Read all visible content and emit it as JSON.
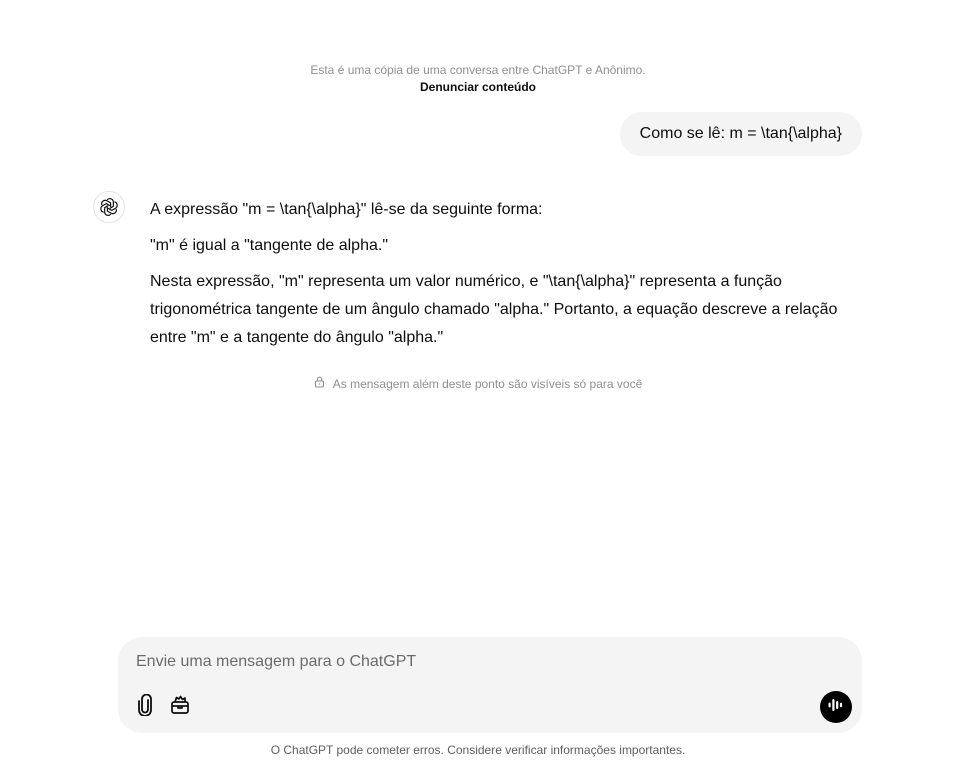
{
  "shared_notice": {
    "text": "Esta é uma cópia de uma conversa entre ChatGPT e Anônimo.",
    "report_link": "Denunciar conteúdo"
  },
  "conversation": {
    "user_message": "Como se lê: m = \\tan{\\alpha}",
    "assistant_paragraphs": [
      "A expressão \"m = \\tan{\\alpha}\" lê-se da seguinte forma:",
      "\"m\" é igual a \"tangente de alpha.\"",
      "Nesta expressão, \"m\" representa um valor numérico, e \"\\tan{\\alpha}\" representa a função trigonométrica tangente de um ângulo chamado \"alpha.\" Portanto, a equação descreve a relação entre \"m\" e a tangente do ângulo \"alpha.\""
    ]
  },
  "private_notice": {
    "icon": "lock-icon",
    "text": "As mensagem além deste ponto são visíveis só para você"
  },
  "composer": {
    "placeholder": "Envie uma mensagem para o ChatGPT",
    "attach_icon": "paperclip-icon",
    "tools_icon": "toolbox-icon",
    "voice_icon": "voice-waveform-icon"
  },
  "footer": {
    "disclaimer": "O ChatGPT pode cometer erros. Considere verificar informações importantes."
  },
  "colors": {
    "bubble_bg": "#f4f4f4",
    "muted_text": "#8f8f8f",
    "voice_button_bg": "#000000"
  }
}
